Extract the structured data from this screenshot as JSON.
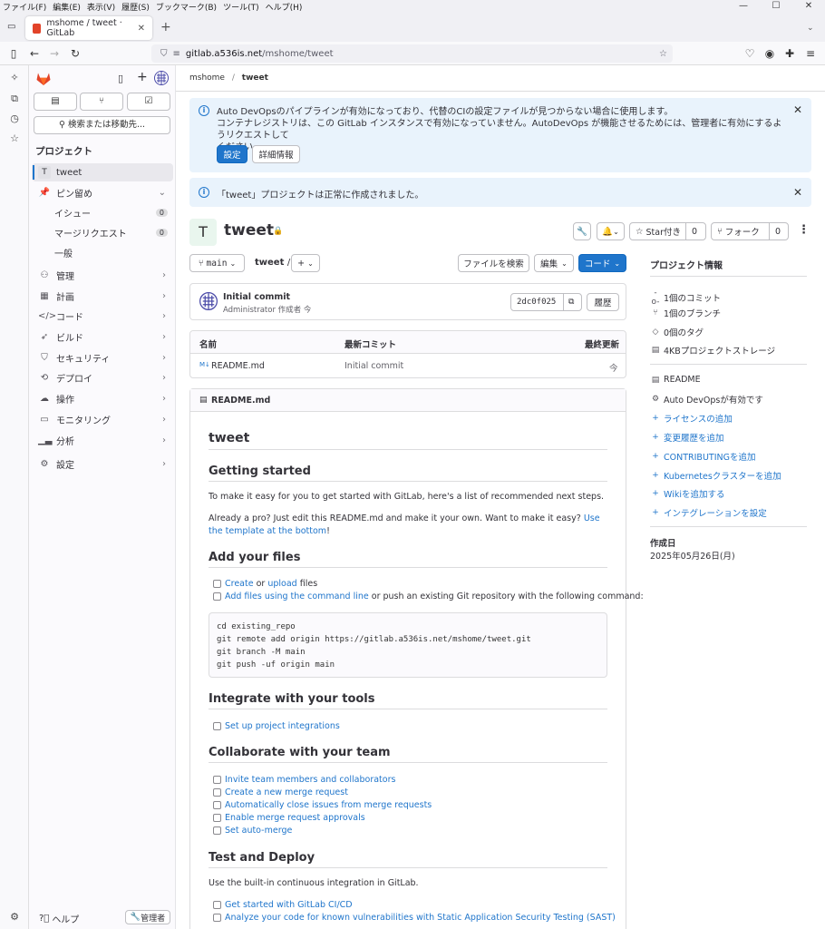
{
  "browser": {
    "menu": [
      "ファイル(F)",
      "編集(E)",
      "表示(V)",
      "履歴(S)",
      "ブックマーク(B)",
      "ツール(T)",
      "ヘルプ(H)"
    ],
    "tab_title": "mshome / tweet · GitLab",
    "url_host": "gitlab.a536is.net",
    "url_path": "/mshome/tweet"
  },
  "sidebar": {
    "search_label": "検索または移動先...",
    "section_title": "プロジェクト",
    "project_letter": "T",
    "project_name": "tweet",
    "pinned": "ピン留め",
    "sub": [
      {
        "label": "イシュー",
        "count": "0"
      },
      {
        "label": "マージリクエスト",
        "count": "0"
      },
      {
        "label": "一般",
        "count": ""
      }
    ],
    "items": [
      "管理",
      "計画",
      "コード",
      "ビルド",
      "セキュリティ",
      "デプロイ",
      "操作",
      "モニタリング",
      "分析"
    ],
    "settings": "設定",
    "help": "ヘルプ",
    "admin": "管理者"
  },
  "breadcrumb": {
    "group": "mshome",
    "sep": "/",
    "project": "tweet"
  },
  "alert1": {
    "line1": "Auto DevOpsのパイプラインが有効になっており、代替のCIの設定ファイルが見つからない場合に使用します。",
    "line2": "コンテナレジストリは、この GitLab インスタンスで有効になっていません。AutoDevOps が機能させるためには、管理者に有効にするようリクエストして",
    "line3": "ください。",
    "btn_settings": "設定",
    "btn_more": "詳細情報"
  },
  "alert2": {
    "text": "「tweet」プロジェクトは正常に作成されました。"
  },
  "project": {
    "avatar": "T",
    "title": "tweet",
    "star_label": "Star付き",
    "star_count": "0",
    "fork_label": "フォーク",
    "fork_count": "0"
  },
  "toolbar": {
    "branch": "main",
    "path": "tweet",
    "path_sep": "/",
    "add": "+",
    "find_file": "ファイルを検索",
    "edit": "編集",
    "code": "コード"
  },
  "commit": {
    "title": "Initial commit",
    "author_line": "Administrator 作成者 今",
    "sha": "2dc0f025",
    "history": "履歴"
  },
  "file_table": {
    "headers": [
      "名前",
      "最新コミット",
      "最終更新"
    ],
    "rows": [
      {
        "name": "README.md",
        "commit": "Initial commit",
        "updated": "今"
      }
    ]
  },
  "readme": {
    "filename": "README.md",
    "h1": "tweet",
    "s1_title": "Getting started",
    "s1_p1": "To make it easy for you to get started with GitLab, here's a list of recommended next steps.",
    "s1_p2_a": "Already a pro? Just edit this README.md and make it your own. Want to make it easy? ",
    "s1_p2_link": "Use the template at the bottom",
    "s1_p2_end": "!",
    "s2_title": "Add your files",
    "s2_c1_link1": "Create",
    "s2_c1_mid": " or ",
    "s2_c1_link2": "upload",
    "s2_c1_end": " files",
    "s2_c2_link": "Add files using the command line",
    "s2_c2_end": " or push an existing Git repository with the following command:",
    "code": "cd existing_repo\ngit remote add origin https://gitlab.a536is.net/mshome/tweet.git\ngit branch -M main\ngit push -uf origin main",
    "s3_title": "Integrate with your tools",
    "s3_items": [
      "Set up project integrations"
    ],
    "s4_title": "Collaborate with your team",
    "s4_items": [
      "Invite team members and collaborators",
      "Create a new merge request",
      "Automatically close issues from merge requests",
      "Enable merge request approvals",
      "Set auto-merge"
    ],
    "s5_title": "Test and Deploy",
    "s5_p": "Use the built-in continuous integration in GitLab.",
    "s5_items": [
      "Get started with GitLab CI/CD",
      "Analyze your code for known vulnerabilities with Static Application Security Testing (SAST)"
    ]
  },
  "right": {
    "title": "プロジェクト情報",
    "stats": [
      "1個のコミット",
      "1個のブランチ",
      "0個のタグ",
      "4KBプロジェクトストレージ"
    ],
    "readme": "README",
    "autodevops": "Auto DevOpsが有効です",
    "links": [
      "ライセンスの追加",
      "変更履歴を追加",
      "CONTRIBUTINGを追加",
      "Kubernetesクラスターを追加",
      "Wikiを追加する",
      "インテグレーションを設定"
    ],
    "created_label": "作成日",
    "created_date": "2025年05月26日(月)"
  }
}
